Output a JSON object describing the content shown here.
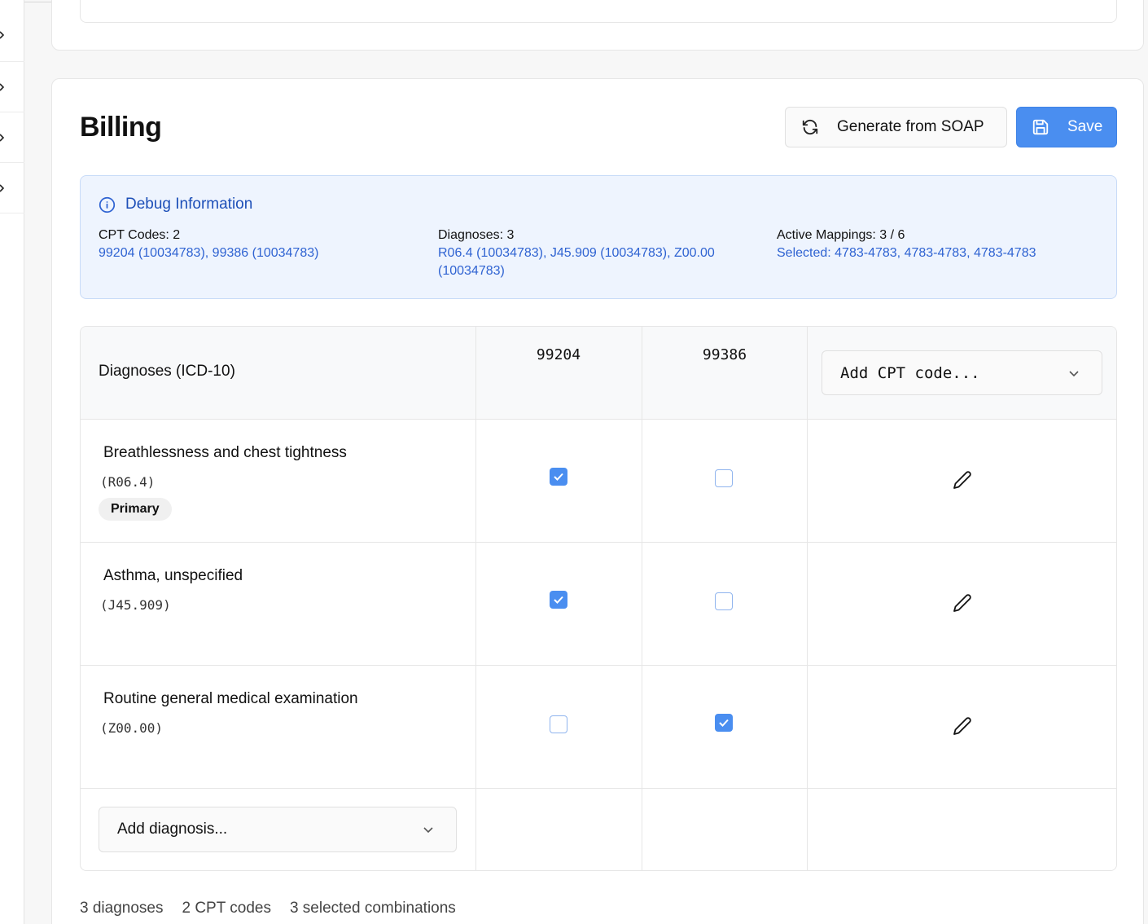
{
  "billing": {
    "title": "Billing",
    "generate_label": "Generate from SOAP",
    "save_label": "Save"
  },
  "debug": {
    "heading": "Debug Information",
    "cpt_label": "CPT Codes: 2",
    "cpt_value": "99204 (10034783), 99386 (10034783)",
    "diag_label": "Diagnoses: 3",
    "diag_value_line1": "R06.4 (10034783), J45.909 (10034783), Z00.00",
    "diag_value_line2": "(10034783)",
    "map_label": "Active Mappings: 3 / 6",
    "map_value": "Selected: 4783-4783, 4783-4783, 4783-4783"
  },
  "table": {
    "diag_header": "Diagnoses (ICD-10)",
    "cpt_codes": [
      "99204",
      "99386"
    ],
    "add_cpt_placeholder": "Add CPT code...",
    "add_diag_placeholder": "Add diagnosis...",
    "rows": [
      {
        "name": "Breathlessness and chest tightness",
        "code": "(R06.4)",
        "badge": "Primary",
        "checks": [
          true,
          false
        ]
      },
      {
        "name": "Asthma, unspecified",
        "code": "(J45.909)",
        "checks": [
          true,
          false
        ]
      },
      {
        "name": "Routine general medical examination",
        "code": "(Z00.00)",
        "checks": [
          false,
          true
        ]
      }
    ]
  },
  "footer": {
    "diagnoses": "3 diagnoses",
    "cpt_codes": "2 CPT codes",
    "combinations": "3 selected combinations"
  },
  "colors": {
    "accent": "#4a8ef0",
    "debug_bg": "#eef4fe",
    "debug_text": "#2f63d2"
  },
  "icons": [
    "chevron-right-icon",
    "refresh-icon",
    "save-icon",
    "info-icon",
    "chevron-down-icon",
    "pencil-icon",
    "check-icon"
  ]
}
